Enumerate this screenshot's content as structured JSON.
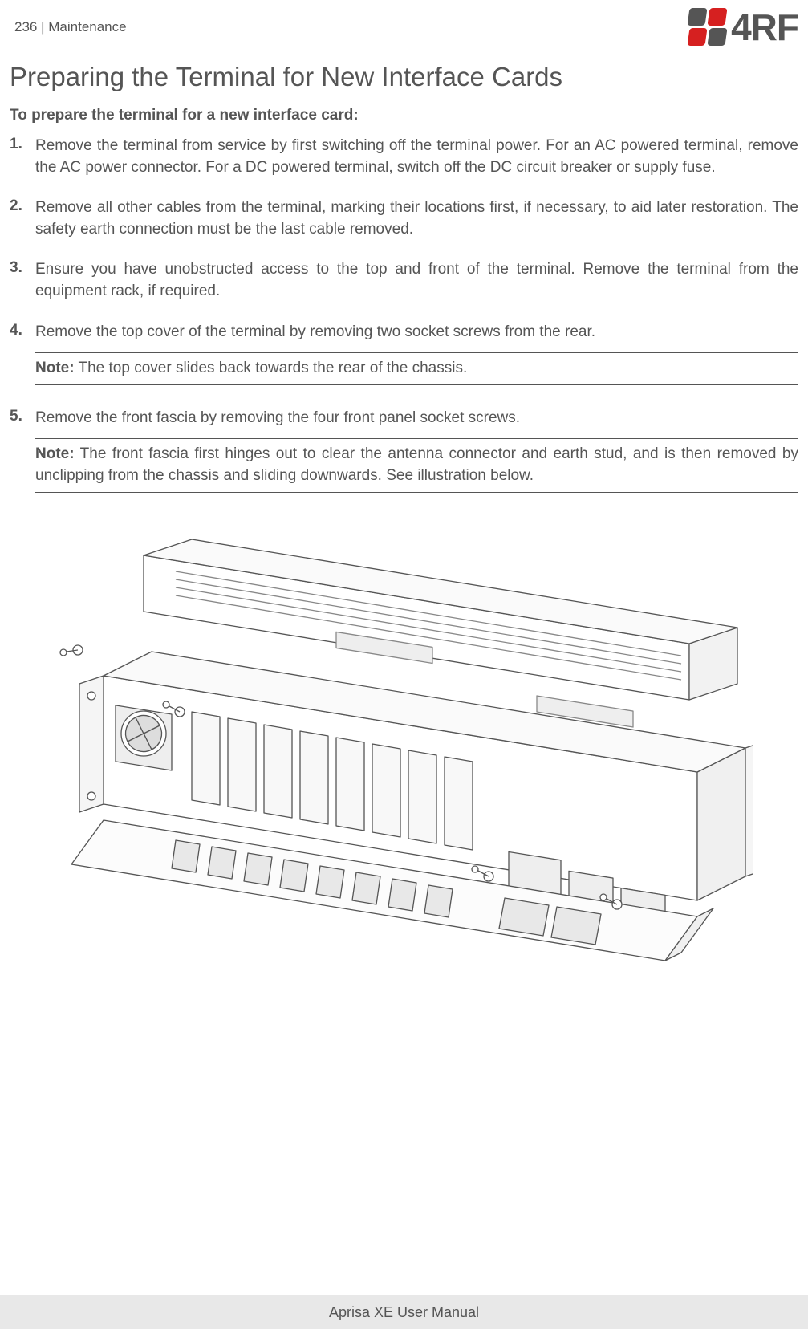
{
  "header": {
    "page_number": "236",
    "divider": " | ",
    "section": "Maintenance",
    "logo_text": "4RF"
  },
  "title": "Preparing the Terminal for New Interface Cards",
  "intro": "To prepare the terminal for a new interface card:",
  "steps": [
    {
      "num": "1.",
      "text": "Remove the terminal from service by first switching off the terminal power. For an AC powered terminal, remove the AC power connector. For a DC powered terminal, switch off the DC circuit breaker or supply fuse."
    },
    {
      "num": "2.",
      "text": "Remove all other cables from the terminal, marking their locations first, if necessary, to aid later restoration. The safety earth connection must be the last cable removed."
    },
    {
      "num": "3.",
      "text": "Ensure you have unobstructed access to the top and front of the terminal. Remove the terminal from the equipment rack, if required."
    },
    {
      "num": "4.",
      "text": "Remove the top cover of the terminal by removing two socket screws from the rear."
    },
    {
      "num": "5.",
      "text": "Remove the front fascia by removing the four front panel socket screws."
    }
  ],
  "notes": {
    "note4_label": "Note:",
    "note4_text": " The top cover slides back towards the rear of the chassis.",
    "note5_label": "Note:",
    "note5_text": " The front fascia first hinges out to clear the antenna connector and earth stud, and is then removed by unclipping from the chassis and sliding downwards. See illustration below."
  },
  "illustration_alt": "Isometric line drawing of terminal chassis with top cover slid back and front fascia hinged downward, showing interface card slots and screws.",
  "footer": "Aprisa XE User Manual"
}
